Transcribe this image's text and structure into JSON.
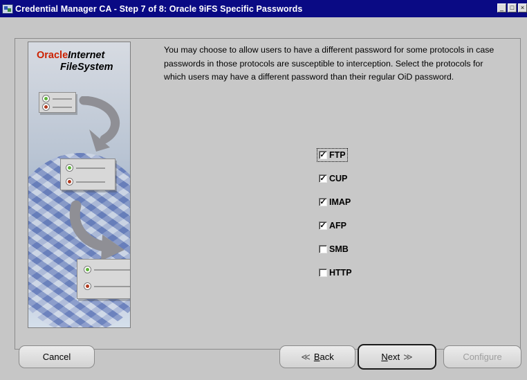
{
  "window": {
    "title": "Credential Manager CA - Step 7 of 8: Oracle 9iFS Specific Passwords",
    "icon": "app-icon",
    "controls": [
      "minimize-icon",
      "maximize-icon",
      "close-icon"
    ]
  },
  "side_panel": {
    "logo_oracle": "Oracle",
    "logo_internet": "Internet",
    "logo_filesystem": "FileSystem"
  },
  "description": "You may choose to allow users to have a different password for some protocols in case passwords in those protocols are susceptible to interception. Select the protocols for which users may have a different password than their regular OiD password.",
  "protocols": [
    {
      "label": "FTP",
      "checked": true
    },
    {
      "label": "CUP",
      "checked": true
    },
    {
      "label": "IMAP",
      "checked": true
    },
    {
      "label": "AFP",
      "checked": true
    },
    {
      "label": "SMB",
      "checked": false
    },
    {
      "label": "HTTP",
      "checked": false
    }
  ],
  "buttons": {
    "cancel": "Cancel",
    "back_arrow": "≪",
    "back_mnemonic": "B",
    "back_rest": "ack",
    "next_mnemonic": "N",
    "next_rest": "ext",
    "next_arrow": "≫",
    "configure": "Configure"
  },
  "colors": {
    "titlebar": "#0a0a84",
    "oracle_red": "#cc2200",
    "window_bg": "#c6c6c6"
  }
}
